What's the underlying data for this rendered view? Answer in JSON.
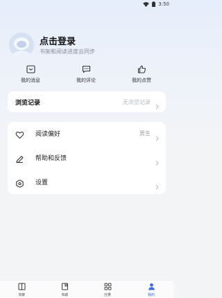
{
  "status_bar": {
    "time": "3:50"
  },
  "profile": {
    "title": "点击登录",
    "subtitle": "书架和阅读进度云同步"
  },
  "shortcuts": [
    {
      "label": "我的消息",
      "icon": "message-box-icon"
    },
    {
      "label": "我的评论",
      "icon": "comment-icon"
    },
    {
      "label": "我的点赞",
      "icon": "thumbs-up-icon"
    }
  ],
  "history": {
    "title": "浏览记录",
    "hint": "无浏览记录"
  },
  "menu": {
    "reading_pref": {
      "label": "阅读偏好",
      "value": "男生",
      "icon": "heart-icon"
    },
    "help": {
      "label": "帮助和反馈",
      "icon": "pencil-icon"
    },
    "settings": {
      "label": "设置",
      "icon": "settings-hex-icon"
    }
  },
  "tabbar": {
    "items": [
      {
        "label": "书架",
        "icon": "bookshelf-icon"
      },
      {
        "label": "书城",
        "icon": "bookstore-icon"
      },
      {
        "label": "分类",
        "icon": "category-grid-icon"
      },
      {
        "label": "我的",
        "icon": "profile-icon"
      }
    ],
    "active_index": 3,
    "accent_color": "#3f6be0"
  }
}
